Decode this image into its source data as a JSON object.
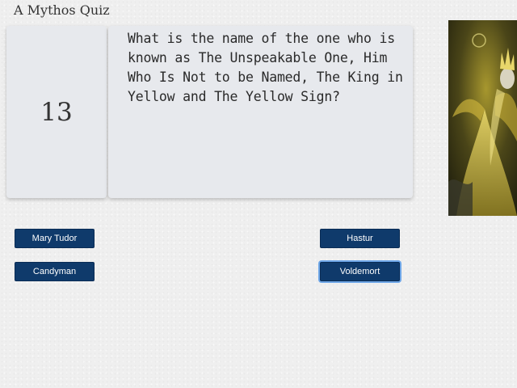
{
  "app": {
    "title": "A Mythos Quiz"
  },
  "question": {
    "number": "13",
    "text": "What is the name of the one who is known as The Unspeakable One, Him Who Is Not to be Named, The King in Yellow and The Yellow Sign?"
  },
  "artwork": {
    "subject": "king-in-yellow-artwork",
    "colors": {
      "dark": "#2b2a14",
      "gold": "#c9b13a",
      "glow": "#e8d76a"
    }
  },
  "answers": [
    {
      "label": "Mary Tudor"
    },
    {
      "label": "Hastur"
    },
    {
      "label": "Candyman"
    },
    {
      "label": "Voldemort"
    }
  ],
  "theme": {
    "button_color": "#0f3a6b",
    "focus_ring": "#6fa7e8",
    "card_color": "#e7e9ed"
  }
}
